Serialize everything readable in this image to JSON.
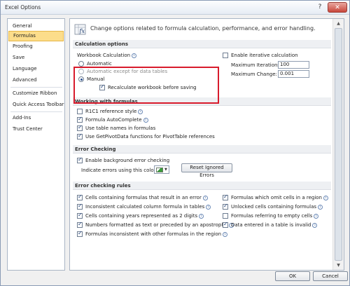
{
  "window": {
    "title": "Excel Options",
    "help": "?",
    "close": "✕"
  },
  "sidebar": {
    "items": [
      {
        "label": "General"
      },
      {
        "label": "Formulas"
      },
      {
        "label": "Proofing"
      },
      {
        "label": "Save"
      },
      {
        "label": "Language"
      },
      {
        "label": "Advanced"
      },
      {
        "label": "Customize Ribbon"
      },
      {
        "label": "Quick Access Toolbar"
      },
      {
        "label": "Add-Ins"
      },
      {
        "label": "Trust Center"
      }
    ],
    "active": "Formulas"
  },
  "intro": {
    "text": "Change options related to formula calculation, performance, and error handling."
  },
  "calc": {
    "header": "Calculation options",
    "workbook_label": "Workbook Calculation",
    "automatic": "Automatic",
    "auto_except": "Automatic except for data tables",
    "manual": "Manual",
    "recalc": "Recalculate workbook before saving",
    "iterative": "Enable iterative calculation",
    "max_iter_label": "Maximum Iterations:",
    "max_iter_value": "100",
    "max_change_label": "Maximum Change:",
    "max_change_value": "0.001"
  },
  "working": {
    "header": "Working with formulas",
    "items": [
      {
        "label": "R1C1 reference style",
        "checked": false
      },
      {
        "label": "Formula AutoComplete",
        "checked": true
      },
      {
        "label": "Use table names in formulas",
        "checked": true
      },
      {
        "label": "Use GetPivotData functions for PivotTable references",
        "checked": true
      }
    ]
  },
  "error_checking": {
    "header": "Error Checking",
    "enable": "Enable background error checking",
    "indicate": "Indicate errors using this color:",
    "reset": "Reset Ignored Errors",
    "color": "#3a9d3a"
  },
  "rules": {
    "header": "Error checking rules",
    "left": [
      {
        "label": "Cells containing formulas that result in an error",
        "checked": true
      },
      {
        "label": "Inconsistent calculated column formula in tables",
        "checked": true
      },
      {
        "label": "Cells containing years represented as 2 digits",
        "checked": true
      },
      {
        "label": "Numbers formatted as text or preceded by an apostrophe",
        "checked": true
      },
      {
        "label": "Formulas inconsistent with other formulas in the region",
        "checked": true
      }
    ],
    "right": [
      {
        "label": "Formulas which omit cells in a region",
        "checked": true
      },
      {
        "label": "Unlocked cells containing formulas",
        "checked": true
      },
      {
        "label": "Formulas referring to empty cells",
        "checked": false
      },
      {
        "label": "Data entered in a table is invalid",
        "checked": true
      }
    ]
  },
  "footer": {
    "ok": "OK",
    "cancel": "Cancel"
  }
}
